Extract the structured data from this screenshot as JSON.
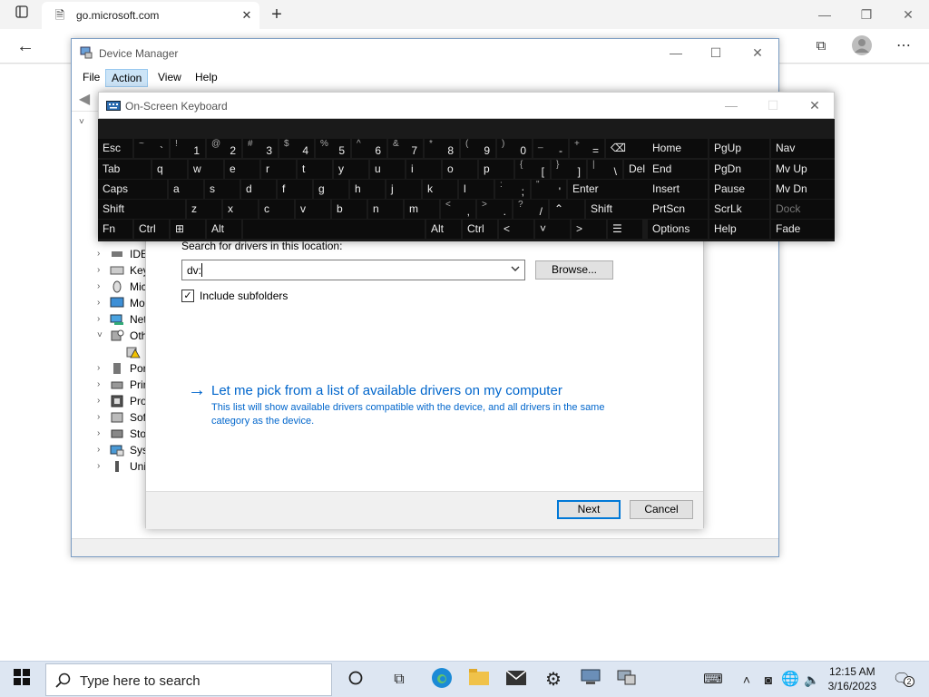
{
  "browser": {
    "tab_title": "go.microsoft.com",
    "new_tab_symbol": "+"
  },
  "device_manager": {
    "title": "Device Manager",
    "menu": [
      "File",
      "Action",
      "View",
      "Help"
    ],
    "tree": [
      {
        "label": "IDE",
        "chevron": "›",
        "icon": "ide-controller-icon"
      },
      {
        "label": "Key",
        "chevron": "›",
        "icon": "keyboard-icon"
      },
      {
        "label": "Mic",
        "chevron": "›",
        "icon": "mouse-icon"
      },
      {
        "label": "Mo",
        "chevron": "›",
        "icon": "monitor-icon"
      },
      {
        "label": "Net",
        "chevron": "›",
        "icon": "network-adapter-icon"
      },
      {
        "label": "Oth",
        "chevron": "˅",
        "icon": "other-devices-icon"
      },
      {
        "label": "",
        "chevron": "",
        "icon": "warning-device-icon"
      },
      {
        "label": "Por",
        "chevron": "›",
        "icon": "port-icon"
      },
      {
        "label": "Prir",
        "chevron": "›",
        "icon": "print-queue-icon"
      },
      {
        "label": "Pro",
        "chevron": "›",
        "icon": "processor-icon"
      },
      {
        "label": "Sof",
        "chevron": "›",
        "icon": "software-device-icon"
      },
      {
        "label": "Sto",
        "chevron": "›",
        "icon": "storage-controller-icon"
      },
      {
        "label": "Syst",
        "chevron": "›",
        "icon": "system-device-icon"
      },
      {
        "label": "Uni",
        "chevron": "›",
        "icon": "usb-icon"
      }
    ]
  },
  "driver_dialog": {
    "search_label": "Search for drivers in this location:",
    "path_value": "dv:",
    "browse_label": "Browse...",
    "include_subfolders_label": "Include subfolders",
    "include_subfolders_checked": "✓",
    "link_title": "Let me pick from a list of available drivers on my computer",
    "link_description": "This list will show available drivers compatible with the device, and all drivers in the same category as the device.",
    "next_label": "Next",
    "cancel_label": "Cancel"
  },
  "osk": {
    "title": "On-Screen Keyboard",
    "rows": [
      [
        {
          "main": "Esc"
        },
        {
          "sub": "~",
          "main": "`"
        },
        {
          "sub": "!",
          "main": "1"
        },
        {
          "sub": "@",
          "main": "2"
        },
        {
          "sub": "#",
          "main": "3"
        },
        {
          "sub": "$",
          "main": "4"
        },
        {
          "sub": "%",
          "main": "5"
        },
        {
          "sub": "^",
          "main": "6"
        },
        {
          "sub": "&",
          "main": "7"
        },
        {
          "sub": "*",
          "main": "8"
        },
        {
          "sub": "(",
          "main": "9"
        },
        {
          "sub": ")",
          "main": "0"
        },
        {
          "sub": "_",
          "main": "-"
        },
        {
          "sub": "+",
          "main": "="
        },
        {
          "main": "⌫"
        }
      ],
      [
        {
          "main": "Tab"
        },
        {
          "main": "q"
        },
        {
          "main": "w"
        },
        {
          "main": "e"
        },
        {
          "main": "r"
        },
        {
          "main": "t"
        },
        {
          "main": "y"
        },
        {
          "main": "u"
        },
        {
          "main": "i"
        },
        {
          "main": "o"
        },
        {
          "main": "p"
        },
        {
          "sub": "{",
          "main": "["
        },
        {
          "sub": "}",
          "main": "]"
        },
        {
          "sub": "|",
          "main": "\\"
        },
        {
          "main": "Del"
        }
      ],
      [
        {
          "main": "Caps"
        },
        {
          "main": "a"
        },
        {
          "main": "s"
        },
        {
          "main": "d"
        },
        {
          "main": "f"
        },
        {
          "main": "g"
        },
        {
          "main": "h"
        },
        {
          "main": "j"
        },
        {
          "main": "k"
        },
        {
          "main": "l"
        },
        {
          "sub": ":",
          "main": ";"
        },
        {
          "sub": "\"",
          "main": "'"
        },
        {
          "main": "Enter"
        }
      ],
      [
        {
          "main": "Shift"
        },
        {
          "main": "z"
        },
        {
          "main": "x"
        },
        {
          "main": "c"
        },
        {
          "main": "v"
        },
        {
          "main": "b"
        },
        {
          "main": "n"
        },
        {
          "main": "m"
        },
        {
          "sub": "<",
          "main": ","
        },
        {
          "sub": ">",
          "main": "."
        },
        {
          "sub": "?",
          "main": "/"
        },
        {
          "main": "⌃"
        },
        {
          "main": "Shift"
        }
      ],
      [
        {
          "main": "Fn"
        },
        {
          "main": "Ctrl"
        },
        {
          "main": "⊞"
        },
        {
          "main": "Alt"
        },
        {
          "main": ""
        },
        {
          "main": "Alt"
        },
        {
          "main": "Ctrl"
        },
        {
          "main": "<"
        },
        {
          "main": "˅"
        },
        {
          "main": ">"
        },
        {
          "main": "☰"
        }
      ]
    ],
    "nav_rows": [
      [
        "Home",
        "PgUp",
        "Nav"
      ],
      [
        "End",
        "PgDn",
        "Mv Up"
      ],
      [
        "Insert",
        "Pause",
        "Mv Dn"
      ],
      [
        "PrtScn",
        "ScrLk",
        "Dock"
      ],
      [
        "Options",
        "Help",
        "Fade"
      ]
    ]
  },
  "taskbar": {
    "search_placeholder": "Type here to search",
    "time": "12:15 AM",
    "date": "3/16/2023",
    "notification_count": "2"
  }
}
